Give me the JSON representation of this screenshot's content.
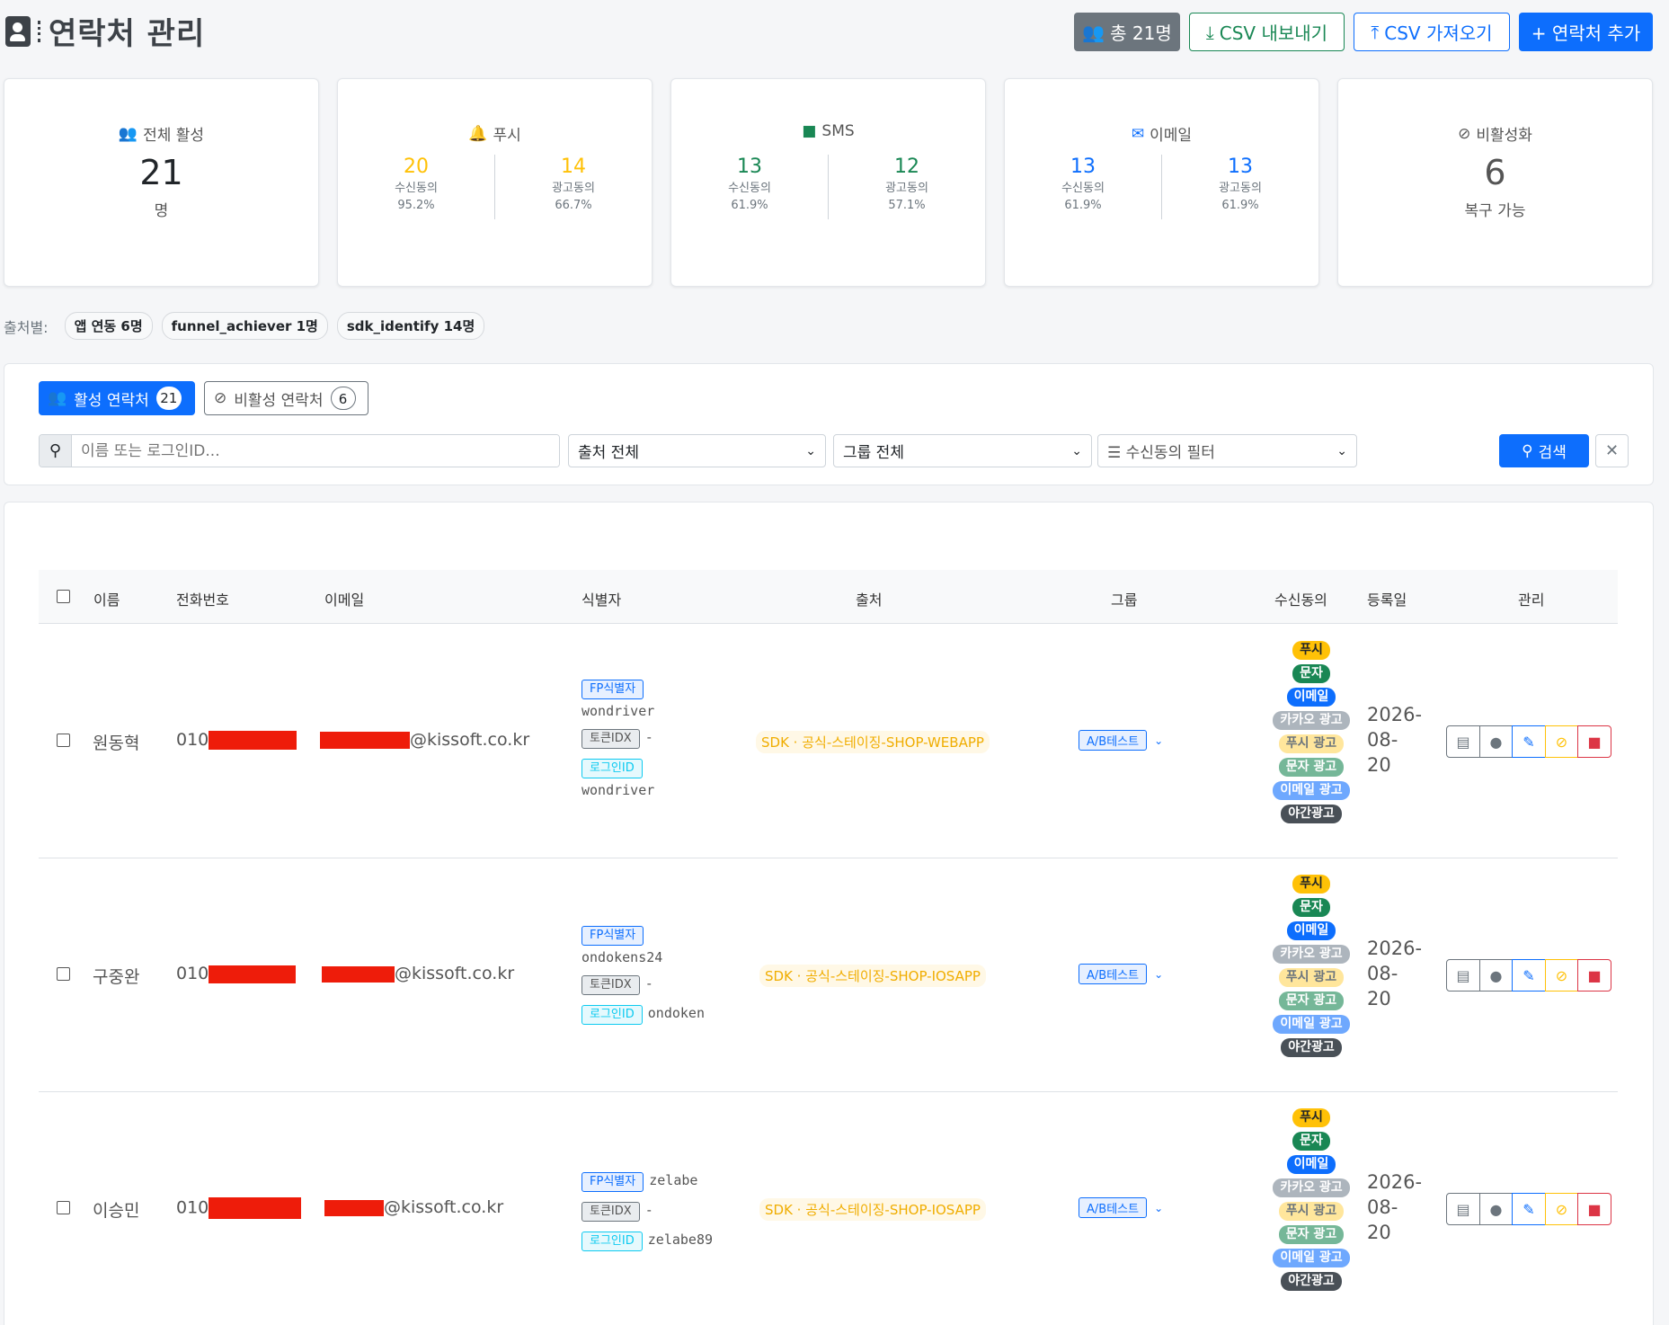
{
  "header": {
    "title": "연락처 관리",
    "total_label": "총 21명",
    "export_label": "CSV 내보내기",
    "import_label": "CSV 가져오기",
    "add_label": "+ 연락처 추가"
  },
  "stats": {
    "active": {
      "title": "전체 활성",
      "value": "21",
      "unit": "명"
    },
    "push": {
      "title": "푸시",
      "consent": "20",
      "consent_label": "수신동의",
      "consent_pct": "95.2%",
      "ad": "14",
      "ad_label": "광고동의",
      "ad_pct": "66.7%",
      "color": "#ffc107"
    },
    "sms": {
      "title": "SMS",
      "consent": "13",
      "consent_label": "수신동의",
      "consent_pct": "61.9%",
      "ad": "12",
      "ad_label": "광고동의",
      "ad_pct": "57.1%",
      "color": "#198754"
    },
    "email": {
      "title": "이메일",
      "consent": "13",
      "consent_label": "수신동의",
      "consent_pct": "61.9%",
      "ad": "13",
      "ad_label": "광고동의",
      "ad_pct": "61.9%",
      "color": "#0d6efd"
    },
    "inactive": {
      "title": "비활성화",
      "value": "6",
      "unit": "복구 가능"
    }
  },
  "sources": {
    "label": "출처별:",
    "chips": [
      "앱 연동 6명",
      "funnel_achiever 1명",
      "sdk_identify 14명"
    ]
  },
  "filters": {
    "tab_active": {
      "label": "활성 연락처",
      "count": "21"
    },
    "tab_inactive": {
      "label": "비활성 연락처",
      "count": "6"
    },
    "search_placeholder": "이름 또는 로그인ID...",
    "source_select": "출처 전체",
    "group_select": "그룹 전체",
    "consent_select": "수신동의 필터",
    "search_button": "검색"
  },
  "table": {
    "headers": {
      "name": "이름",
      "phone": "전화번호",
      "email": "이메일",
      "identifier": "식별자",
      "source": "출처",
      "group": "그룹",
      "consent": "수신동의",
      "registered": "등록일",
      "manage": "관리"
    },
    "id_labels": {
      "fp": "FP식별자",
      "token": "토큰IDX",
      "login": "로그인ID"
    },
    "consent_labels": {
      "push": "푸시",
      "sms": "문자",
      "email": "이메일",
      "kakao_ad": "카카오 광고",
      "push_ad": "푸시 광고",
      "sms_ad": "문자 광고",
      "email_ad": "이메일 광고",
      "night_ad": "야간광고"
    },
    "rows": [
      {
        "name": "원동혁",
        "phone_prefix": "010",
        "email_suffix": "@kissoft.co.kr",
        "fp_id": "wondriver",
        "token_idx": "-",
        "login_id": "wondriver",
        "source": "SDK · 공식-스테이징-SHOP-WEBAPP",
        "group": "A/B테스트",
        "date_y": "2026-",
        "date_m": "08-",
        "date_d": "20"
      },
      {
        "name": "구중완",
        "phone_prefix": "010",
        "email_suffix": "@kissoft.co.kr",
        "fp_id": "ondokens24",
        "token_idx": "-",
        "login_id": "ondoken",
        "source": "SDK · 공식-스테이징-SHOP-IOSAPP",
        "group": "A/B테스트",
        "date_y": "2026-",
        "date_m": "08-",
        "date_d": "20"
      },
      {
        "name": "이승민",
        "phone_prefix": "010",
        "email_suffix": "@kissoft.co.kr",
        "fp_id": "zelabe",
        "token_idx": "-",
        "login_id": "zelabe89",
        "source": "SDK · 공식-스테이징-SHOP-IOSAPP",
        "group": "A/B테스트",
        "date_y": "2026-",
        "date_m": "08-",
        "date_d": "20"
      }
    ]
  }
}
